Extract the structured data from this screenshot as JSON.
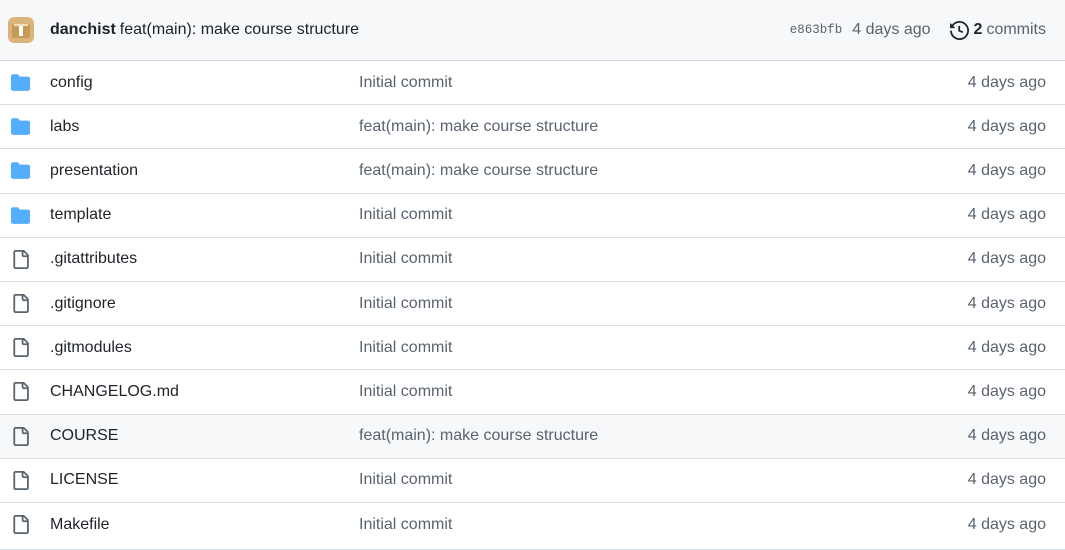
{
  "latest_commit": {
    "author": "danchist",
    "message": "feat(main): make course structure",
    "sha": "e863bfb",
    "time": "4 days ago",
    "commit_count": "2",
    "commits_label": "commits"
  },
  "files": [
    {
      "type": "folder",
      "name": "config",
      "message": "Initial commit",
      "time": "4 days ago"
    },
    {
      "type": "folder",
      "name": "labs",
      "message": "feat(main): make course structure",
      "time": "4 days ago"
    },
    {
      "type": "folder",
      "name": "presentation",
      "message": "feat(main): make course structure",
      "time": "4 days ago"
    },
    {
      "type": "folder",
      "name": "template",
      "message": "Initial commit",
      "time": "4 days ago"
    },
    {
      "type": "file",
      "name": ".gitattributes",
      "message": "Initial commit",
      "time": "4 days ago"
    },
    {
      "type": "file",
      "name": ".gitignore",
      "message": "Initial commit",
      "time": "4 days ago"
    },
    {
      "type": "file",
      "name": ".gitmodules",
      "message": "Initial commit",
      "time": "4 days ago"
    },
    {
      "type": "file",
      "name": "CHANGELOG.md",
      "message": "Initial commit",
      "time": "4 days ago"
    },
    {
      "type": "file",
      "name": "COURSE",
      "message": "feat(main): make course structure",
      "time": "4 days ago",
      "hovered": true
    },
    {
      "type": "file",
      "name": "LICENSE",
      "message": "Initial commit",
      "time": "4 days ago"
    },
    {
      "type": "file",
      "name": "Makefile",
      "message": "Initial commit",
      "time": "4 days ago"
    }
  ],
  "colors": {
    "folder_icon": "#54aeff",
    "file_icon": "#59636e",
    "avatar": "#d4a96a"
  }
}
